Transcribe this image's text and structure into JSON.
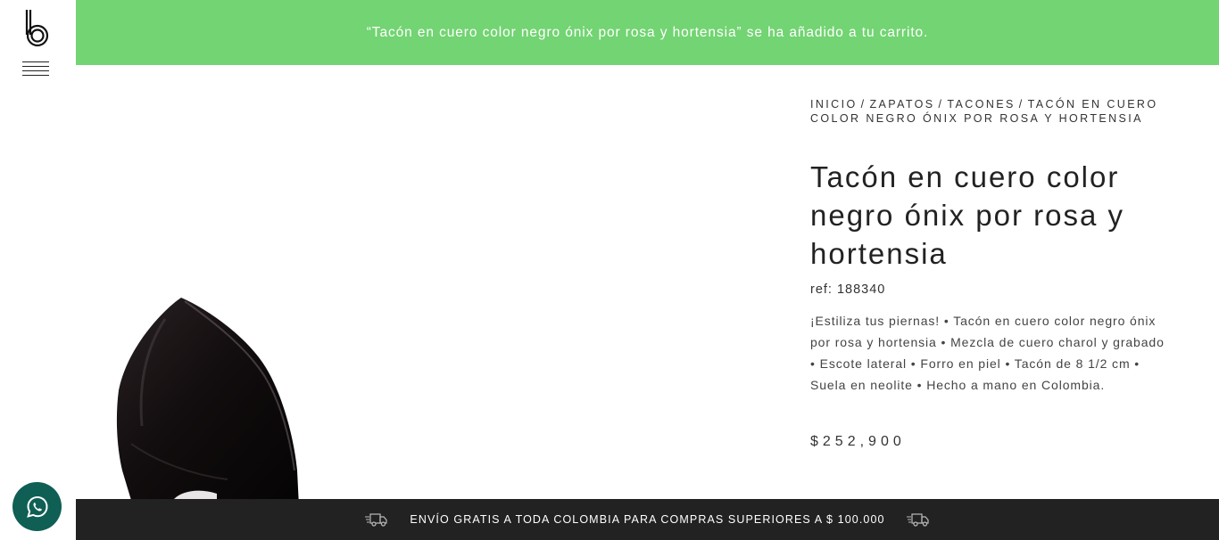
{
  "notice": {
    "message": "“Tacón en cuero color negro ónix por rosa y hortensia” se ha añadido a tu carrito."
  },
  "breadcrumb": {
    "home": "INICIO",
    "separator": "/",
    "category": "ZAPATOS",
    "subcategory": "TACONES",
    "current": "TACÓN EN CUERO COLOR NEGRO ÓNIX POR ROSA Y HORTENSIA"
  },
  "product": {
    "title": "Tacón en cuero color negro ónix por rosa y hortensia",
    "ref": "ref: 188340",
    "description": "¡Estiliza tus piernas! • Tacón en cuero color negro ónix por rosa y hortensia • Mezcla de cuero charol y grabado • Escote lateral • Forro en piel • Tacón de 8 1/2 cm • Suela en neolite • Hecho a mano en Colombia.",
    "price": "$252,900"
  },
  "shipping_bar": {
    "text": "ENVÍO GRATIS A TODA COLOMBIA PARA COMPRAS SUPERIORES A $ 100.000",
    "icon": "delivery-truck-icon"
  },
  "icons": {
    "logo": "b-logo",
    "menu": "hamburger-menu-icon",
    "whatsapp": "whatsapp-icon"
  },
  "colors": {
    "notice_bg": "#72d472",
    "shipping_bg": "#222222",
    "whatsapp_bg": "#0f5f54"
  }
}
